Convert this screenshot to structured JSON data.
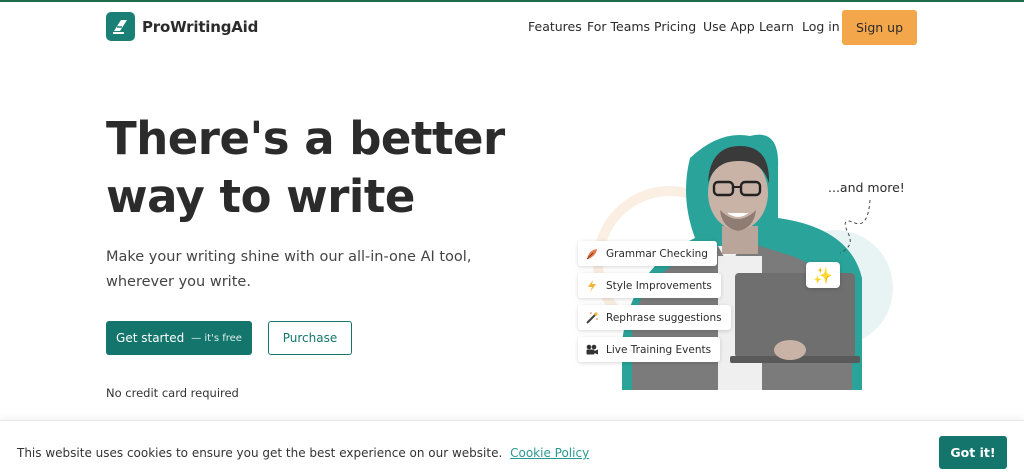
{
  "brand": {
    "name": "ProWritingAid",
    "accent": "#13756b",
    "cta_color": "#f3a64a"
  },
  "nav": {
    "features": "Features",
    "for_teams": "For Teams",
    "pricing": "Pricing",
    "use_app": "Use App",
    "learn": "Learn",
    "login": "Log in",
    "signup": "Sign up"
  },
  "hero": {
    "title_line1": "There's a better",
    "title_line2": "way to write",
    "subtitle_line1": "Make your writing shine with our all-in-one AI tool,",
    "subtitle_line2": "wherever you write.",
    "cta_primary": "Get started",
    "cta_primary_note": "— it's free",
    "cta_secondary": "Purchase",
    "note": "No credit card required"
  },
  "features_cards": [
    {
      "label": "Grammar Checking",
      "icon": "feather-icon"
    },
    {
      "label": "Style Improvements",
      "icon": "lightning-icon"
    },
    {
      "label": "Rephrase suggestions",
      "icon": "magic-wand-icon"
    },
    {
      "label": "Live Training Events",
      "icon": "video-camera-icon"
    }
  ],
  "illustration": {
    "more_text": "...and more!"
  },
  "cookie": {
    "text": "This website uses cookies to ensure you get the best experience on our website.",
    "link": "Cookie Policy",
    "button": "Got it!"
  }
}
